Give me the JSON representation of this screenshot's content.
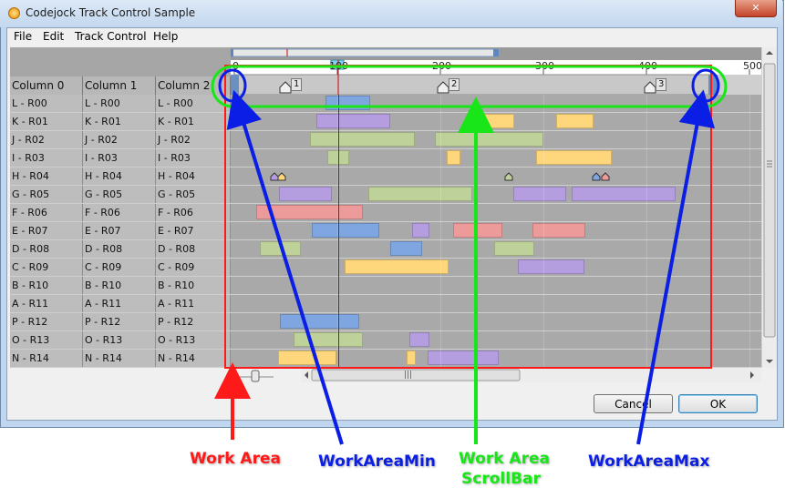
{
  "window": {
    "title": "Codejock Track Control Sample",
    "close_glyph": "✕"
  },
  "menu": [
    "File",
    "Edit",
    "Track Control",
    "Help"
  ],
  "columns": [
    "Column 0",
    "Column 1",
    "Column 2"
  ],
  "rows": [
    [
      "L - R00",
      "L - R00",
      "L - R00"
    ],
    [
      "K - R01",
      "K - R01",
      "K - R01"
    ],
    [
      "J - R02",
      "J - R02",
      "J - R02"
    ],
    [
      "I - R03",
      "I - R03",
      "I - R03"
    ],
    [
      "H - R04",
      "H - R04",
      "H - R04"
    ],
    [
      "G - R05",
      "G - R05",
      "G - R05"
    ],
    [
      "F - R06",
      "F - R06",
      "F - R06"
    ],
    [
      "E - R07",
      "E - R07",
      "E - R07"
    ],
    [
      "D - R08",
      "D - R08",
      "D - R08"
    ],
    [
      "C - R09",
      "C - R09",
      "C - R09"
    ],
    [
      "B - R10",
      "B - R10",
      "B - R10"
    ],
    [
      "A - R11",
      "A - R11",
      "A - R11"
    ],
    [
      "P - R12",
      "P - R12",
      "P - R12"
    ],
    [
      "O - R13",
      "O - R13",
      "O - R13"
    ],
    [
      "N - R14",
      "N - R14",
      "N - R14"
    ]
  ],
  "ruler": {
    "ticks": [
      "0",
      "100",
      "200",
      "300",
      "400",
      "500"
    ]
  },
  "markers": [
    "1",
    "2",
    "3"
  ],
  "buttons": {
    "cancel": "Cancel",
    "ok": "OK"
  },
  "hscroll_grip": "|||",
  "annotations": {
    "work_area": "Work Area",
    "work_area_min": "WorkAreaMin",
    "work_area_scrollbar_line1": "Work Area",
    "work_area_scrollbar_line2": "ScrollBar",
    "work_area_max": "WorkAreaMax"
  },
  "colors": {
    "work_area": "#ff1a1a",
    "work_area_min": "#0a1ee6",
    "work_area_scrollbar": "#19e619",
    "work_area_max": "#0a1ee6"
  }
}
